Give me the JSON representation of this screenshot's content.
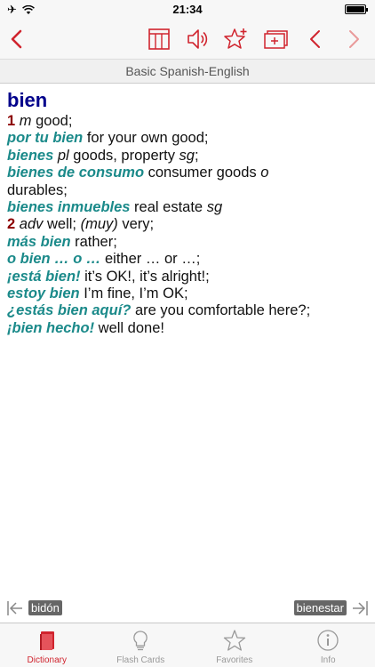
{
  "status": {
    "time": "21:34",
    "airplane": "✈",
    "wifi": "wifi-icon"
  },
  "toolbar": {
    "back": "chevron-left-icon",
    "table": "table-icon",
    "speaker": "speaker-icon",
    "add_favorite": "star-plus-icon",
    "add_card": "card-plus-icon",
    "prev": "chevron-left-icon",
    "next": "chevron-right-icon"
  },
  "dictionary_name": "Basic Spanish-English",
  "entry": {
    "headword": "bien",
    "sense1": {
      "num": "1",
      "pos": "m",
      "def": " good;"
    },
    "l2": {
      "phrase": "por tu bien",
      "def": " for your own good;"
    },
    "l3": {
      "phrase": "bienes",
      "pos": "pl",
      "def": " goods, property ",
      "tag": "sg",
      "end": ";"
    },
    "l4": {
      "phrase": "bienes de consumo",
      "def": " consumer goods ",
      "tag": "o"
    },
    "l5": {
      "def": "durables;"
    },
    "l6": {
      "phrase": "bienes inmuebles",
      "def": " real estate ",
      "tag": "sg"
    },
    "sense2": {
      "num": "2",
      "pos": "adv",
      "def": " well; ",
      "note": "(muy)",
      "def2": " very;"
    },
    "l8": {
      "phrase": "más bien",
      "def": " rather;"
    },
    "l9": {
      "phrase": "o bien … o …",
      "def": " either … or …;"
    },
    "l10": {
      "phrase": "¡está bien!",
      "def": " it’s OK!, it’s alright!;"
    },
    "l11": {
      "phrase": "estoy bien",
      "def": " I’m fine, I’m OK;"
    },
    "l12": {
      "phrase": "¿estás bien aquí?",
      "def": " are you comfortable here?;"
    },
    "l13": {
      "phrase": "¡bien hecho!",
      "def": " well done!"
    }
  },
  "nav": {
    "previous_word": "bidón",
    "next_word": "bienestar"
  },
  "tabs": [
    {
      "label": "Dictionary",
      "icon": "book-icon",
      "active": true
    },
    {
      "label": "Flash Cards",
      "icon": "lightbulb-icon",
      "active": false
    },
    {
      "label": "Favorites",
      "icon": "star-icon",
      "active": false
    },
    {
      "label": "Info",
      "icon": "info-icon",
      "active": false
    }
  ],
  "colors": {
    "accent": "#d0242e",
    "headword": "#00008b",
    "phrase": "#1b8a8a",
    "sense_number": "#8b0000"
  }
}
